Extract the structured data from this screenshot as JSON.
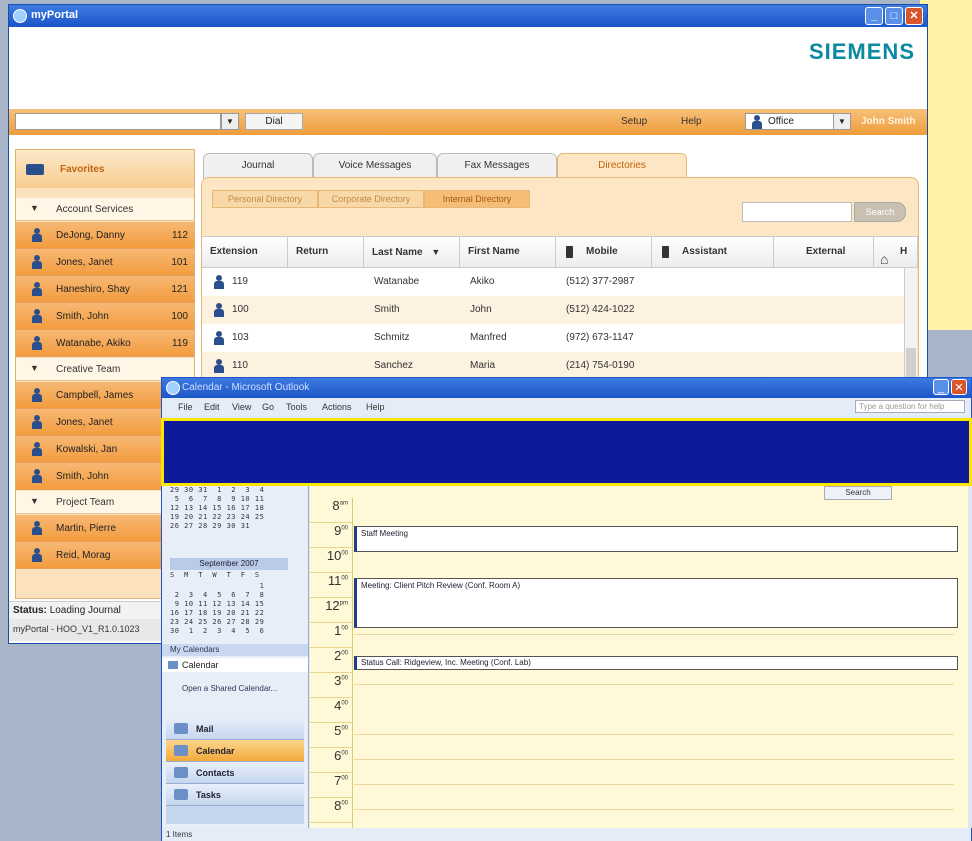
{
  "portal": {
    "title": "myPortal",
    "brand": "SIEMENS",
    "dial_label": "Dial",
    "setup_label": "Setup",
    "help_label": "Help",
    "presence": "Office",
    "user": "John Smith"
  },
  "favorites": {
    "title": "Favorites",
    "groups": [
      {
        "name": "Account Services",
        "contacts": [
          {
            "name": "DeJong, Danny",
            "ext": "112"
          },
          {
            "name": "Jones, Janet",
            "ext": "101"
          },
          {
            "name": "Haneshiro, Shay",
            "ext": "121"
          },
          {
            "name": "Smith, John",
            "ext": "100"
          },
          {
            "name": "Watanabe, Akiko",
            "ext": "119"
          }
        ]
      },
      {
        "name": "Creative Team",
        "contacts": [
          {
            "name": "Campbell, James",
            "ext": ""
          },
          {
            "name": "Jones, Janet",
            "ext": ""
          },
          {
            "name": "Kowalski, Jan",
            "ext": ""
          },
          {
            "name": "Smith, John",
            "ext": ""
          }
        ]
      },
      {
        "name": "Project Team",
        "contacts": [
          {
            "name": "Martin, Pierre",
            "ext": ""
          },
          {
            "name": "Reid, Morag",
            "ext": ""
          }
        ]
      }
    ]
  },
  "status": {
    "label": "Status:",
    "text": "Loading Journal"
  },
  "footer": "myPortal - HOO_V1_R1.0.1023",
  "tabs": [
    {
      "label": "Journal"
    },
    {
      "label": "Voice Messages"
    },
    {
      "label": "Fax Messages"
    },
    {
      "label": "Directories"
    }
  ],
  "subtabs": [
    {
      "label": "Personal Directory"
    },
    {
      "label": "Corporate Directory"
    },
    {
      "label": "Internal Directory"
    }
  ],
  "search_label": "Search",
  "grid": {
    "headers": [
      "Extension",
      "Return",
      "Last Name",
      "First Name",
      "Mobile",
      "Assistant",
      "External",
      "H"
    ],
    "rows": [
      {
        "ext": "119",
        "last": "Watanabe",
        "first": "Akiko",
        "mobile": "(512) 377-2987"
      },
      {
        "ext": "100",
        "last": "Smith",
        "first": "John",
        "mobile": "(512) 424-1022"
      },
      {
        "ext": "103",
        "last": "Schmitz",
        "first": "Manfred",
        "mobile": "(972) 673-1147"
      },
      {
        "ext": "110",
        "last": "Sanchez",
        "first": "Maria",
        "mobile": "(214) 754-0190"
      }
    ]
  },
  "outlook": {
    "title": "Calendar - Microsoft Outlook",
    "menu": [
      "File",
      "Edit",
      "View",
      "Go",
      "Tools",
      "Actions",
      "Help"
    ],
    "ask_placeholder": "Type a question for help",
    "month_title": "September 2007",
    "weekday_row": "S  M  T  W  T  F  S",
    "aug_rows": [
      "29 30 31  1  2  3  4",
      " 5  6  7  8  9 10 11",
      "12 13 14 15 16 17 18",
      "19 20 21 22 23 24 25",
      "26 27 28 29 30 31"
    ],
    "sep_rows": [
      "                   1",
      " 2  3  4  5  6  7  8",
      " 9 10 11 12 13 14 15",
      "16 17 18 19 20 21 22",
      "23 24 25 26 27 28 29",
      "30  1  2  3  4  5  6"
    ],
    "my_calendars": "My Calendars",
    "calendar_item": "Calendar",
    "open_shared": "Open a Shared Calendar...",
    "nav": [
      "Mail",
      "Calendar",
      "Contacts",
      "Tasks"
    ],
    "status": "1 Items",
    "search_chip": "Search",
    "hours": [
      {
        "h": "8",
        "m": "am"
      },
      {
        "h": "9",
        "m": "00"
      },
      {
        "h": "10",
        "m": "00"
      },
      {
        "h": "11",
        "m": "00"
      },
      {
        "h": "12",
        "m": "pm"
      },
      {
        "h": "1",
        "m": "00"
      },
      {
        "h": "2",
        "m": "00"
      },
      {
        "h": "3",
        "m": "00"
      },
      {
        "h": "4",
        "m": "00"
      },
      {
        "h": "5",
        "m": "00"
      },
      {
        "h": "6",
        "m": "00"
      },
      {
        "h": "7",
        "m": "00"
      },
      {
        "h": "8",
        "m": "00"
      }
    ],
    "appointments": [
      {
        "text": "Staff Meeting"
      },
      {
        "text": "Meeting: Client Pitch Review (Conf. Room A)"
      },
      {
        "text": "Status Call: Ridgeview, Inc. Meeting (Conf. Lab)"
      }
    ]
  },
  "colors": {
    "brand": "#0a8aa0",
    "accent": "#ef9c3a",
    "banner": "#0e1a9a",
    "banner_border": "#f8e600"
  }
}
